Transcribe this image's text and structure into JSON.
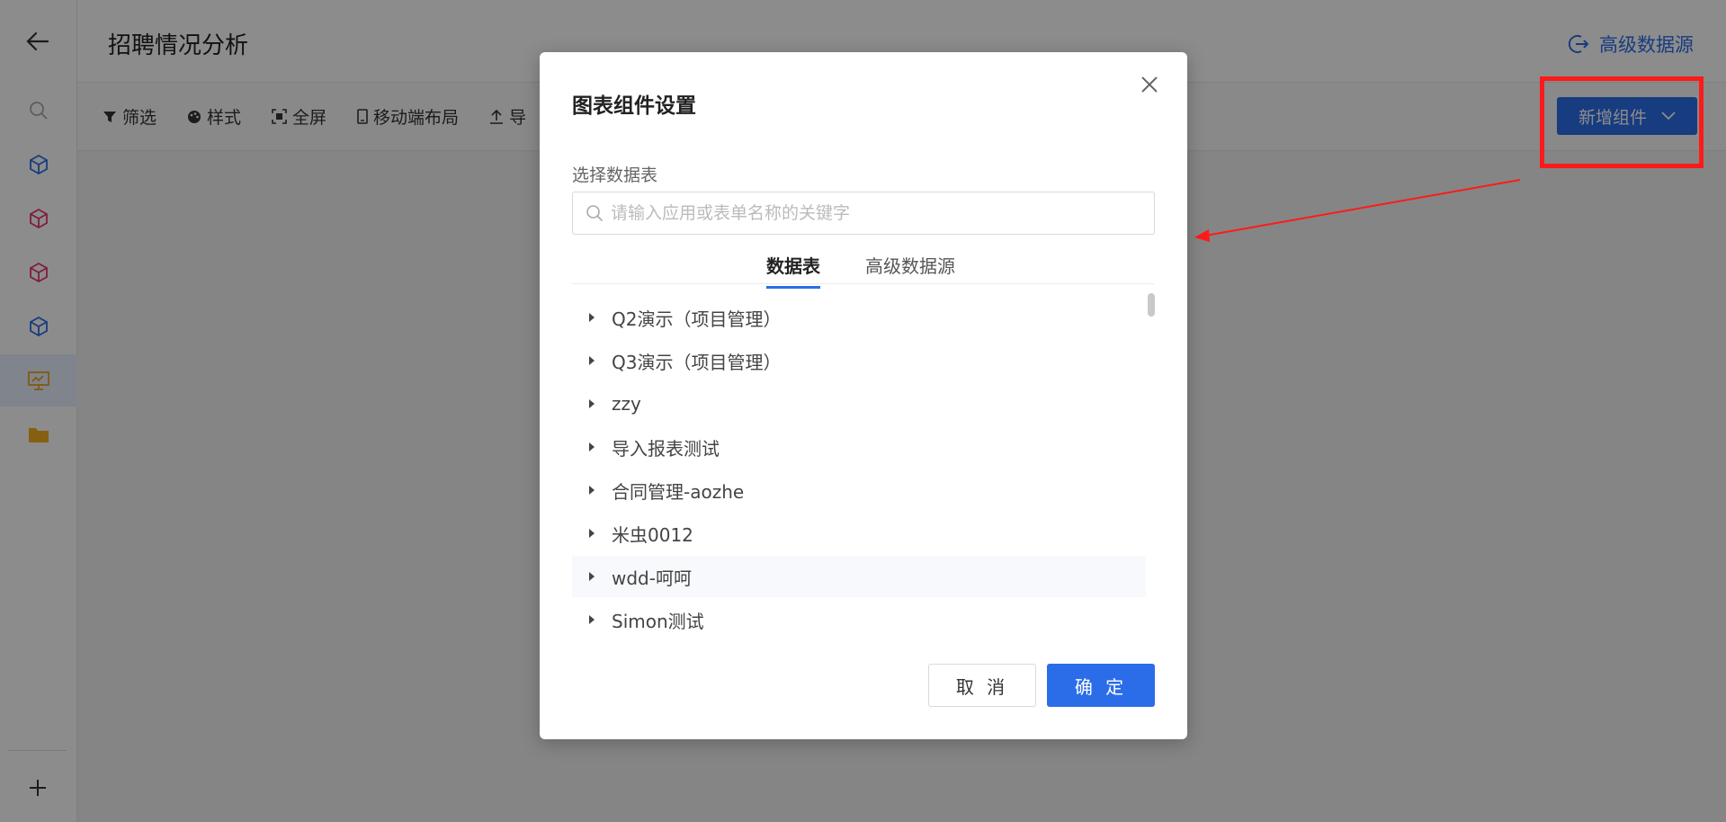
{
  "header": {
    "title": "招聘情况分析",
    "advanced_source_label": "高级数据源"
  },
  "toolbar": {
    "tools": [
      {
        "label": "筛选",
        "icon": "filter-icon"
      },
      {
        "label": "样式",
        "icon": "palette-icon"
      },
      {
        "label": "全屏",
        "icon": "fullscreen-icon"
      },
      {
        "label": "移动端布局",
        "icon": "mobile-icon"
      },
      {
        "label": "导",
        "icon": "upload-icon"
      }
    ],
    "add_component_label": "新增组件"
  },
  "sidebar": {
    "icons": [
      "cube-icon-blue",
      "cube-icon-red",
      "cube-icon-red",
      "cube-icon-blue",
      "dashboard-icon",
      "folder-icon"
    ]
  },
  "modal": {
    "title": "图表组件设置",
    "select_table_label": "选择数据表",
    "search_placeholder": "请输入应用或表单名称的关键字",
    "tabs": [
      "数据表",
      "高级数据源"
    ],
    "active_tab": "数据表",
    "items": [
      "Q2演示（项目管理）",
      "Q3演示（项目管理）",
      "zzy",
      "导入报表测试",
      "合同管理-aozhe",
      "米虫0012",
      "wdd-呵呵",
      "Simon测试"
    ],
    "cancel_label": "取 消",
    "ok_label": "确 定"
  },
  "colors": {
    "primary": "#2b6de8",
    "annotation": "#ff1a1a"
  }
}
